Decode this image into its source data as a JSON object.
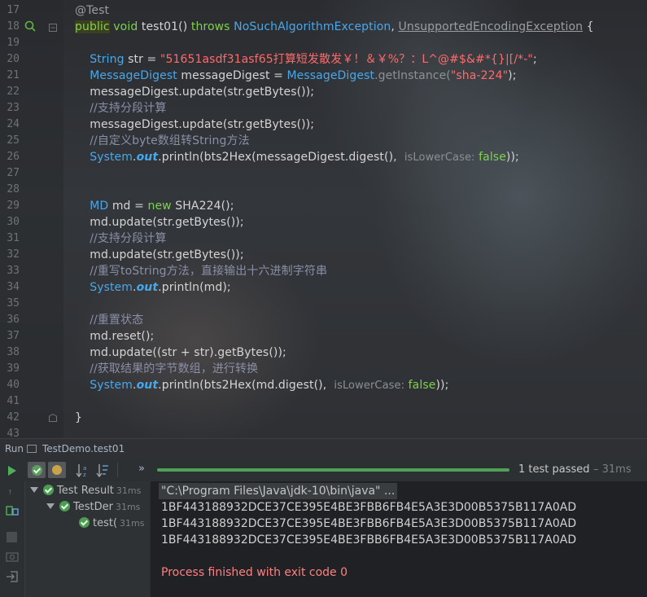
{
  "editor": {
    "lines": [
      {
        "n": "17",
        "segs": [
          {
            "c": "t-ann",
            "t": "@Test"
          }
        ]
      },
      {
        "n": "18",
        "segs": [
          {
            "c": "t-kw hl",
            "t": "public"
          },
          {
            "c": "t-plain",
            "t": " "
          },
          {
            "c": "t-kw",
            "t": "void"
          },
          {
            "c": "t-plain",
            "t": " test01() "
          },
          {
            "c": "t-kw",
            "t": "throws"
          },
          {
            "c": "t-plain",
            "t": " "
          },
          {
            "c": "t-type",
            "t": "NoSuchAlgorithmException"
          },
          {
            "c": "t-plain",
            "t": ", "
          },
          {
            "c": "t-under",
            "t": "UnsupportedEncodingException"
          },
          {
            "c": "t-plain",
            "t": " {"
          }
        ]
      },
      {
        "n": "19",
        "segs": []
      },
      {
        "n": "20",
        "segs": [
          {
            "c": "t-plain",
            "t": "    "
          },
          {
            "c": "t-type",
            "t": "String"
          },
          {
            "c": "t-plain",
            "t": " str = "
          },
          {
            "c": "t-str",
            "t": "\"51651asdf31asf65打算短发散发￥！＆￥%？：L^@#$&#*{}|[/*-\""
          },
          {
            "c": "t-plain",
            "t": ";"
          }
        ]
      },
      {
        "n": "21",
        "segs": [
          {
            "c": "t-plain",
            "t": "    "
          },
          {
            "c": "t-type",
            "t": "MessageDigest"
          },
          {
            "c": "t-plain",
            "t": " messageDigest = "
          },
          {
            "c": "t-type",
            "t": "MessageDigest"
          },
          {
            "c": "t-gray",
            "t": ".getInstance("
          },
          {
            "c": "t-str",
            "t": "\"sha-224\""
          },
          {
            "c": "t-plain",
            "t": ");"
          }
        ]
      },
      {
        "n": "22",
        "segs": [
          {
            "c": "t-plain",
            "t": "    messageDigest.update(str.getBytes());"
          }
        ]
      },
      {
        "n": "23",
        "segs": [
          {
            "c": "t-plain",
            "t": "    "
          },
          {
            "c": "t-cmt",
            "t": "//支持分段计算"
          }
        ]
      },
      {
        "n": "24",
        "segs": [
          {
            "c": "t-plain",
            "t": "    messageDigest.update(str.getBytes());"
          }
        ]
      },
      {
        "n": "25",
        "segs": [
          {
            "c": "t-plain",
            "t": "    "
          },
          {
            "c": "t-cmt",
            "t": "//自定义byte数组转String方法"
          }
        ]
      },
      {
        "n": "26",
        "segs": [
          {
            "c": "t-plain",
            "t": "    "
          },
          {
            "c": "t-type",
            "t": "System"
          },
          {
            "c": "t-plain",
            "t": "."
          },
          {
            "c": "t-field",
            "t": "out"
          },
          {
            "c": "t-plain",
            "t": ".println(bts2Hex(messageDigest.digest(),  "
          },
          {
            "c": "t-hint",
            "t": "isLowerCase:"
          },
          {
            "c": "t-plain",
            "t": " "
          },
          {
            "c": "t-kw",
            "t": "false"
          },
          {
            "c": "t-plain",
            "t": "));"
          }
        ]
      },
      {
        "n": "27",
        "segs": []
      },
      {
        "n": "28",
        "segs": []
      },
      {
        "n": "29",
        "segs": [
          {
            "c": "t-plain",
            "t": "    "
          },
          {
            "c": "t-type",
            "t": "MD"
          },
          {
            "c": "t-plain",
            "t": " md = "
          },
          {
            "c": "t-kw",
            "t": "new"
          },
          {
            "c": "t-plain",
            "t": " SHA224();"
          }
        ]
      },
      {
        "n": "30",
        "segs": [
          {
            "c": "t-plain",
            "t": "    md.update(str.getBytes());"
          }
        ]
      },
      {
        "n": "31",
        "segs": [
          {
            "c": "t-plain",
            "t": "    "
          },
          {
            "c": "t-cmt",
            "t": "//支持分段计算"
          }
        ]
      },
      {
        "n": "32",
        "segs": [
          {
            "c": "t-plain",
            "t": "    md.update(str.getBytes());"
          }
        ]
      },
      {
        "n": "33",
        "segs": [
          {
            "c": "t-plain",
            "t": "    "
          },
          {
            "c": "t-cmt",
            "t": "//重写toString方法，直接输出十六进制字符串"
          }
        ]
      },
      {
        "n": "34",
        "segs": [
          {
            "c": "t-plain",
            "t": "    "
          },
          {
            "c": "t-type",
            "t": "System"
          },
          {
            "c": "t-plain",
            "t": "."
          },
          {
            "c": "t-field",
            "t": "out"
          },
          {
            "c": "t-plain",
            "t": ".println(md);"
          }
        ]
      },
      {
        "n": "35",
        "segs": []
      },
      {
        "n": "36",
        "segs": [
          {
            "c": "t-plain",
            "t": "    "
          },
          {
            "c": "t-cmt",
            "t": "//重置状态"
          }
        ]
      },
      {
        "n": "37",
        "segs": [
          {
            "c": "t-plain",
            "t": "    md.reset();"
          }
        ]
      },
      {
        "n": "38",
        "segs": [
          {
            "c": "t-plain",
            "t": "    md.update((str + str).getBytes());"
          }
        ]
      },
      {
        "n": "39",
        "segs": [
          {
            "c": "t-plain",
            "t": "    "
          },
          {
            "c": "t-cmt",
            "t": "//获取结果的字节数组，进行转换"
          }
        ]
      },
      {
        "n": "40",
        "segs": [
          {
            "c": "t-plain",
            "t": "    "
          },
          {
            "c": "t-type",
            "t": "System"
          },
          {
            "c": "t-plain",
            "t": "."
          },
          {
            "c": "t-field",
            "t": "out"
          },
          {
            "c": "t-plain",
            "t": ".println(bts2Hex(md.digest(),  "
          },
          {
            "c": "t-hint",
            "t": "isLowerCase:"
          },
          {
            "c": "t-plain",
            "t": " "
          },
          {
            "c": "t-kw",
            "t": "false"
          },
          {
            "c": "t-plain",
            "t": "));"
          }
        ]
      },
      {
        "n": "41",
        "segs": []
      },
      {
        "n": "42",
        "segs": [
          {
            "c": "t-plain",
            "t": "}"
          }
        ]
      },
      {
        "n": "43",
        "segs": []
      }
    ]
  },
  "run_panel": {
    "title": "Run",
    "config_name": "TestDemo.test01",
    "status_text": "1 test passed",
    "status_duration": "– 31ms",
    "more_label": "»"
  },
  "tree": {
    "items": [
      {
        "label": "Test Result",
        "duration": "31ms"
      },
      {
        "label": "TestDer",
        "duration": "31ms"
      },
      {
        "label": "test(",
        "duration": "31ms"
      }
    ]
  },
  "console": {
    "command": "\"C:\\Program Files\\Java\\jdk-10\\bin\\java\" ...",
    "outputs": [
      "1BF443188932DCE37CE395E4BE3FBB6FB4E5A3E3D00B5375B117A0AD",
      "1BF443188932DCE37CE395E4BE3FBB6FB4E5A3E3D00B5375B117A0AD",
      "1BF443188932DCE37CE395E4BE3FBB6FB4E5A3E3D00B5375B117A0AD"
    ],
    "exit_message": "Process finished with exit code 0"
  },
  "colors": {
    "keyword": "#7fd14f",
    "type": "#4aa7e8",
    "string": "#ff6b6b",
    "comment": "#8a8fa6",
    "pass": "#4c9c52",
    "exit": "#ff8080"
  },
  "icons": [
    "run-gutter-icon",
    "fold-icon",
    "run-icon",
    "pause-icon",
    "sort-alpha-icon",
    "sort-duration-icon",
    "check-icon",
    "stop-icon",
    "rerun-icon"
  ]
}
